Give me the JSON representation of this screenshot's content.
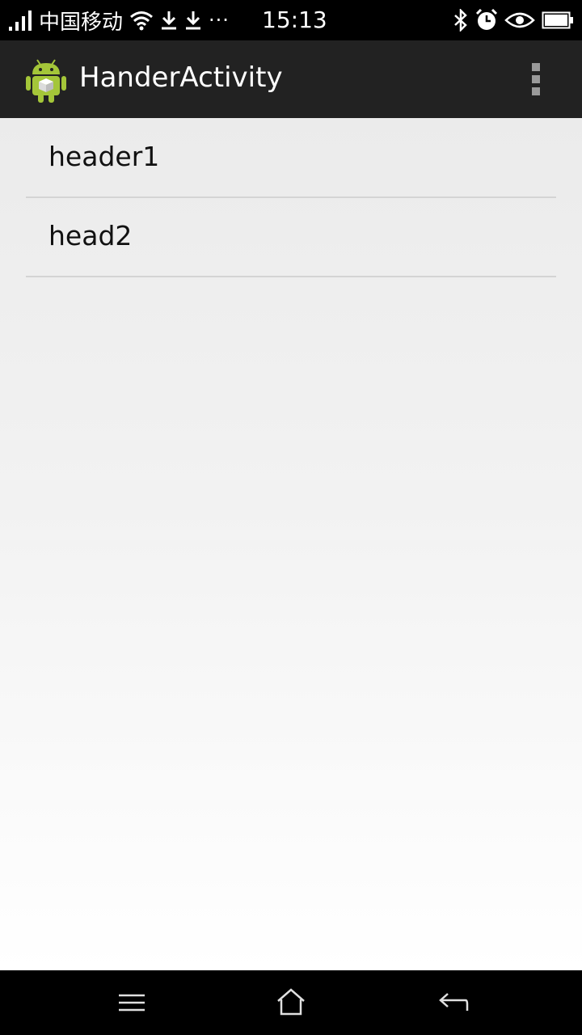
{
  "status_bar": {
    "carrier": "中国移动",
    "time": "15:13",
    "overflow_dots": "···",
    "icons": [
      "signal-icon",
      "wifi-icon",
      "download-icon",
      "download-icon",
      "bluetooth-icon",
      "alarm-icon",
      "eye-icon",
      "battery-icon"
    ]
  },
  "action_bar": {
    "title": "HanderActivity",
    "app_icon": "android-icon",
    "menu_icon": "overflow-menu-icon",
    "accent_color": "#A4C639",
    "background_color": "#222222"
  },
  "list": {
    "items": [
      {
        "label": "header1"
      },
      {
        "label": "head2"
      }
    ]
  },
  "nav_bar": {
    "buttons": [
      "menu-icon",
      "home-icon",
      "back-icon"
    ]
  }
}
